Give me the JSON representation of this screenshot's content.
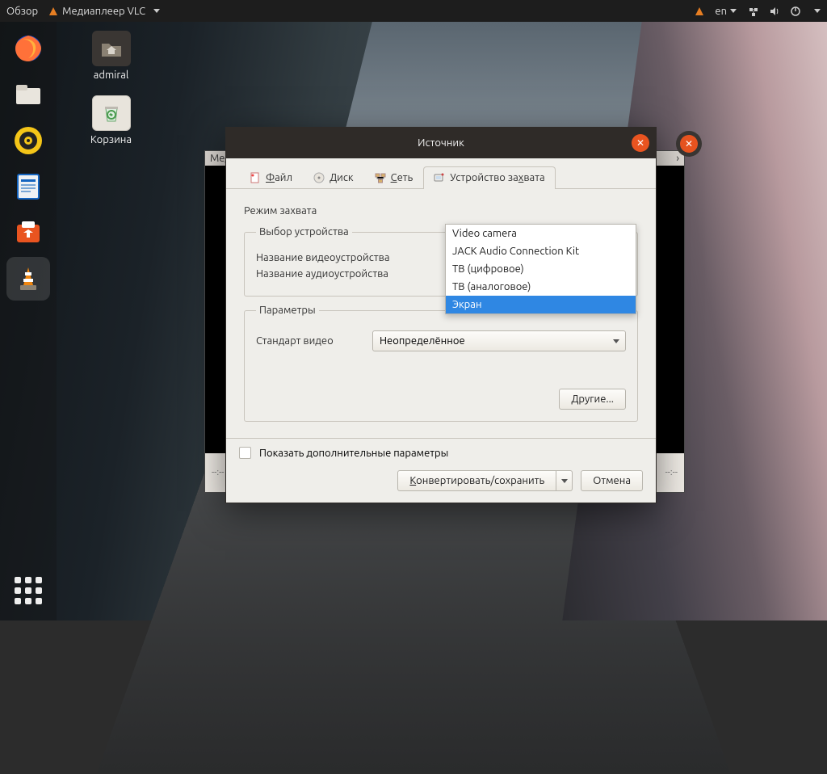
{
  "topbar": {
    "activities": "Обзор",
    "app_label": "Медиаплеер VLC",
    "lang": "en"
  },
  "desktop": {
    "home_label": "admiral",
    "trash_label": "Корзина"
  },
  "vlc_bg": {
    "title_fragment": "Мед",
    "time_left": "--:--",
    "time_right": "--:--"
  },
  "dialog": {
    "title": "Источник",
    "tabs": {
      "file_pre": "",
      "file_u": "Ф",
      "file_post": "айл",
      "disc_pre": "",
      "disc_u": "Д",
      "disc_post": "иск",
      "net_pre": "",
      "net_u": "С",
      "net_post": "еть",
      "cap_pre": "Устройство за",
      "cap_u": "х",
      "cap_post": "вата"
    },
    "capture_mode_label": "Режим захвата",
    "device_section": "Выбор устройства",
    "video_dev_label": "Название видеоустройства",
    "audio_dev_label": "Название аудиоустройства",
    "params_section": "Параметры",
    "video_std_label": "Стандарт видео",
    "video_std_value": "Неопределённое",
    "more_btn": "Другие...",
    "show_more_label": "Показать дополнительные параметры",
    "convert_pre": "",
    "convert_u": "К",
    "convert_post": "онвертировать/сохранить",
    "cancel": "Отмена",
    "dropdown": {
      "0": "Video camera",
      "1": "JACK Audio Connection Kit",
      "2": "ТВ (цифровое)",
      "3": "ТВ (аналоговое)",
      "4": "Экран"
    }
  }
}
